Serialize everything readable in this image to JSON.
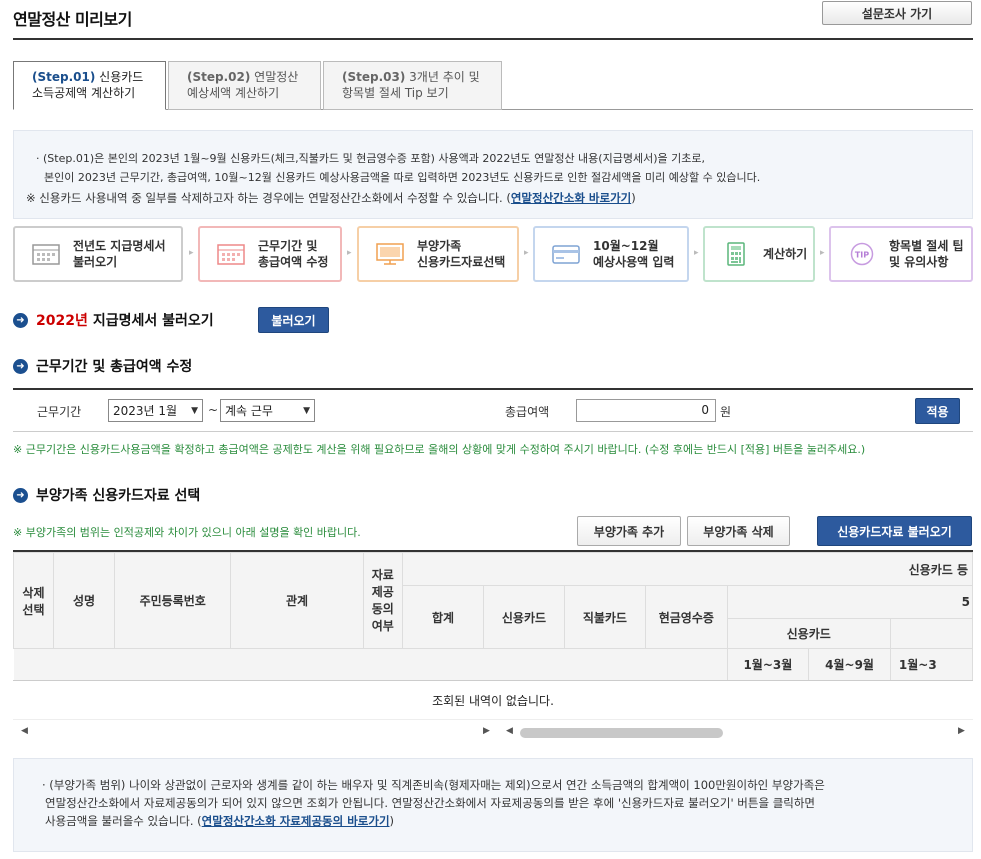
{
  "page": {
    "title": "연말정산 미리보기",
    "survey_button": "설문조사 가기"
  },
  "tabs": [
    {
      "step": "(Step.01)",
      "line1": " 신용카드",
      "line2": "소득공제액 계산하기"
    },
    {
      "step": "(Step.02)",
      "line1": " 연말정산",
      "line2": "예상세액 계산하기"
    },
    {
      "step": "(Step.03)",
      "line1": " 3개년 추이 및",
      "line2": "항목별 절세 Tip 보기"
    }
  ],
  "info": {
    "line1": "· (Step.01)은 본인의 2023년 1월~9월 신용카드(체크,직불카드 및 현금영수증 포함) 사용액과 2022년도 연말정산 내용(지급명세서)을 기초로,",
    "line2": "본인이 2023년 근무기간, 총급여액, 10월~12월 신용카드 예상사용금액을 따로 입력하면 2023년도 신용카드로 인한 절감세액을 미리 예상할 수 있습니다.",
    "note_prefix": "※ 신용카드 사용내역 중 일부를 삭제하고자 하는 경우에는 연말정산간소화에서 수정할 수 있습니다. (",
    "note_link": "연말정산간소화 바로가기",
    "note_suffix": ")"
  },
  "process_steps": [
    {
      "line1": "전년도 지급명세서",
      "line2": "불러오기",
      "color": "#cccccc"
    },
    {
      "line1": "근무기간 및",
      "line2": "총급여액 수정",
      "color": "#f2b8b8"
    },
    {
      "line1": "부양가족",
      "line2": "신용카드자료선택",
      "color": "#f6cfa6"
    },
    {
      "line1": "10월~12월",
      "line2": "예상사용액 입력",
      "color": "#c4d6ee"
    },
    {
      "line1": "계산하기",
      "line2": "",
      "color": "#bfe3cc"
    },
    {
      "line1": "항목별 절세 팁",
      "line2": "및 유의사항",
      "color": "#dcc3ec"
    }
  ],
  "section_load": {
    "year": "2022년",
    "title": "지급명세서 불러오기",
    "button": "불러오기"
  },
  "section_period": {
    "title": "근무기간 및 총급여액 수정",
    "period_label": "근무기간",
    "start_value": "2023년 1월",
    "tilde": "~",
    "end_value": "계속 근무",
    "salary_label": "총급여액",
    "salary_value": "0",
    "unit": "원",
    "apply_button": "적용",
    "note": "※ 근무기간은 신용카드사용금액을 확정하고 총급여액은 공제한도 계산을 위해 필요하므로 올해의 상황에 맞게 수정하여 주시기 바랍니다. (수정 후에는 반드시 [적용] 버튼을 눌러주세요.)"
  },
  "section_family": {
    "title": "부양가족 신용카드자료 선택",
    "note": "※ 부양가족의 범위는 인적공제와 차이가 있으니 아래 설명을 확인 바랍니다.",
    "add_button": "부양가족 추가",
    "delete_button": "부양가족 삭제",
    "load_button": "신용카드자료 불러오기"
  },
  "grid": {
    "col_delete": "삭제\n선택",
    "col_name": "성명",
    "col_id": "주민등록번호",
    "col_relation": "관계",
    "col_consent": "자료\n제공\n동의\n여부",
    "group_card": "신용카드 등",
    "group_sub": "5",
    "col_total": "합계",
    "col_credit": "신용카드",
    "col_debit": "직불카드",
    "col_cash": "현금영수증",
    "sub_credit": "신용카드",
    "m1": "1월~3월",
    "m2": "4월~9월",
    "m3": "1월~3",
    "empty": "조회된 내역이 없습니다."
  },
  "bottom": {
    "line1": "· (부양가족 범위) 나이와 상관없이 근로자와 생계를 같이 하는 배우자 및 직계존비속(형제자매는 제외)으로서 연간 소득금액의 합계액이 100만원이하인 부양가족은",
    "line2": "연말정산간소화에서 자료제공동의가 되어 있지 않으면 조회가 안됩니다. 연말정산간소화에서 자료제공동의를 받은 후에 '신용카드자료 불러오기' 버튼을 클릭하면",
    "line3_prefix": "사용금액을 불러올수 있습니다. (",
    "line3_link": "연말정산간소화 자료제공동의 바로가기",
    "line3_suffix": ")"
  }
}
